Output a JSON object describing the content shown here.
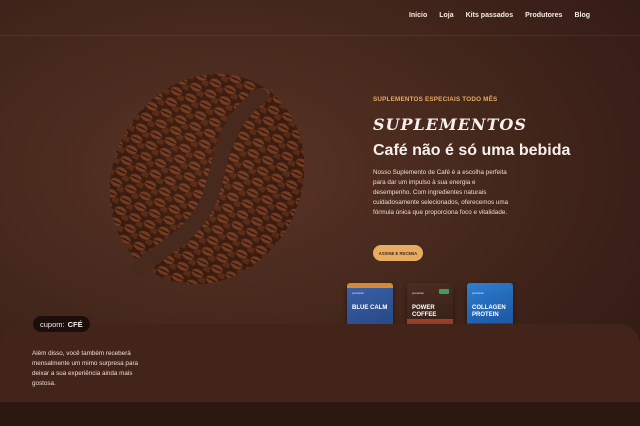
{
  "nav": {
    "links": [
      "Início",
      "Loja",
      "Kits passados",
      "Produtores",
      "Blog"
    ]
  },
  "hero": {
    "eyebrow": "SUPLEMENTOS ESPECIAIS TODO MÊS",
    "script_title": "SUPLEMENTOS",
    "headline": "Café não é só uma bebida",
    "description": "Nosso Suplemento de Café é a escolha perfeita para dar um impulso à sua energia e desempenho. Com ingredientes naturais cuidadosamente selecionados, oferecemos uma fórmula única que proporciona foco e vitalidade.",
    "cta_label": "ASSINE E RECEBA"
  },
  "products": [
    {
      "brand": "puravida",
      "name": "BLUE CALM",
      "color": "#2a4b8a"
    },
    {
      "brand": "puravida",
      "name": "POWER COFFEE",
      "color": "#3a2219"
    },
    {
      "brand": "puravida",
      "name": "COLLAGEN PROTEIN",
      "color": "#1f5fae"
    }
  ],
  "coupon": {
    "prefix": "cupom:",
    "code": "CFÉ"
  },
  "bonus_text": "Além disso, você também receberá mensalmente um mimo surpresa para deixar a sua experiência ainda mais gostosa.",
  "colors": {
    "accent": "#e6ad62",
    "background": "#47291d"
  }
}
